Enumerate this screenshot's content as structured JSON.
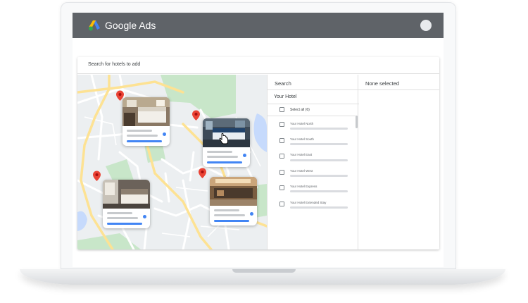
{
  "app": {
    "title": "Google Ads"
  },
  "search": {
    "placeholder": "Search for hotels to add"
  },
  "list_panel": {
    "title": "Search",
    "group_label": "Your Hotel",
    "select_all_label": "Select all (6)",
    "items": [
      {
        "label": "Your Hotel North"
      },
      {
        "label": "Your Hotel South"
      },
      {
        "label": "Your Hotel East"
      },
      {
        "label": "Your Hotel West"
      },
      {
        "label": "Your Hotel Express"
      },
      {
        "label": "Your Hotel Extended Stay"
      }
    ]
  },
  "selected_panel": {
    "title": "None selected"
  },
  "colors": {
    "header": "#5f6368",
    "pin": "#ea4335",
    "accent": "#4285f4",
    "park": "#c8e6c9",
    "water": "#c6dafc",
    "road": "#fde293"
  }
}
